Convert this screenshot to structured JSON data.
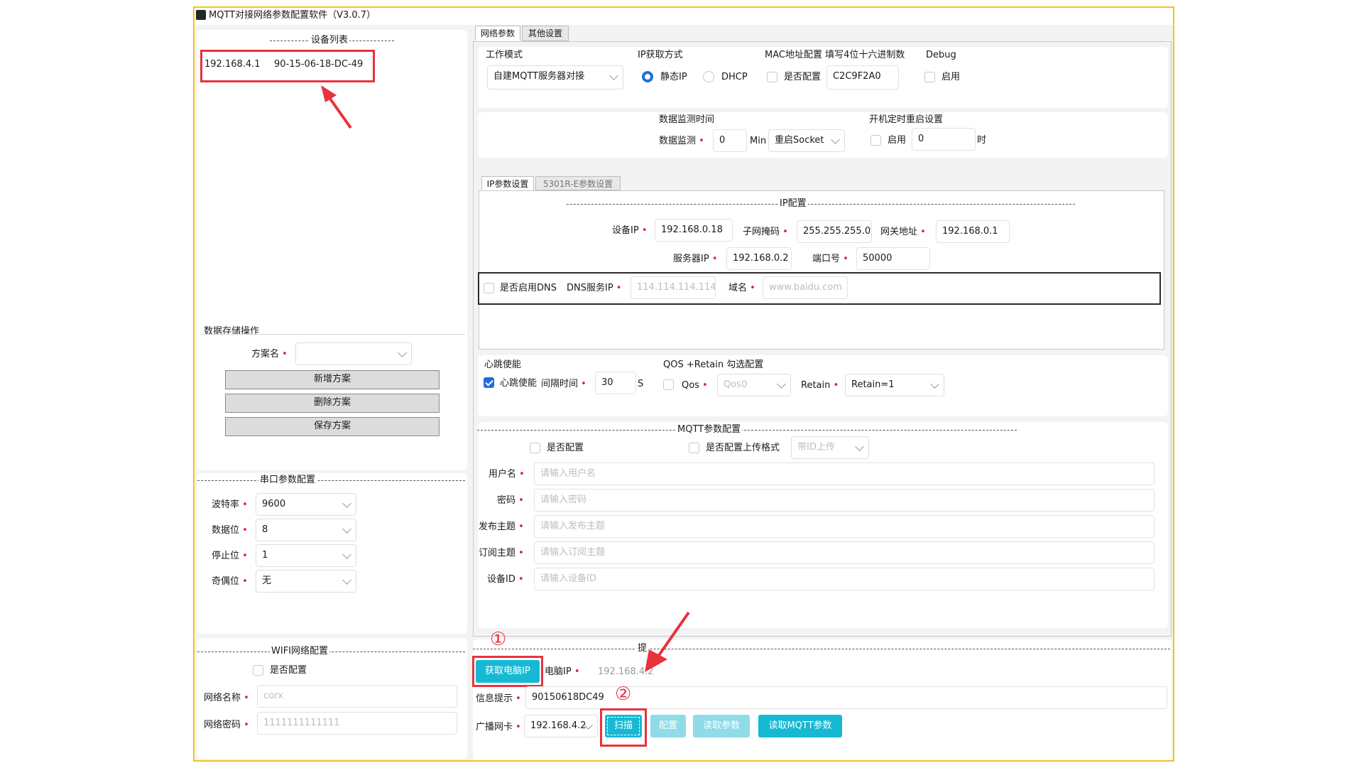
{
  "window": {
    "title": "MQTT对接网络参数配置软件（V3.0.7）"
  },
  "device_list": {
    "header": "设备列表",
    "items": [
      {
        "ip": "192.168.4.1",
        "mac": "90-15-06-18-DC-49"
      }
    ]
  },
  "data_storage": {
    "title": "数据存储操作",
    "scheme_label": "方案名",
    "scheme_value": "",
    "add_label": "新增方案",
    "delete_label": "删除方案",
    "save_label": "保存方案"
  },
  "serial": {
    "title": "串口参数配置",
    "baud_label": "波特率",
    "baud_value": "9600",
    "databits_label": "数据位",
    "databits_value": "8",
    "stopbits_label": "停止位",
    "stopbits_value": "1",
    "parity_label": "奇偶位",
    "parity_value": "无"
  },
  "wifi": {
    "title": "WIFI网络配置",
    "enable_label": "是否配置",
    "ssid_label": "网络名称",
    "ssid_placeholder": "corx",
    "password_label": "网络密码",
    "password_placeholder": "1111111111111"
  },
  "tabs": {
    "network": "网络参数",
    "other": "其他设置"
  },
  "work_mode": {
    "title": "工作模式",
    "value": "自建MQTT服务器对接"
  },
  "ip_mode": {
    "title": "IP获取方式",
    "static_label": "静态IP",
    "dhcp_label": "DHCP",
    "selected": "static"
  },
  "mac_config": {
    "title": "MAC地址配置 填写4位十六进制数",
    "enable_label": "是否配置",
    "value": "C2C9F2A0"
  },
  "debug": {
    "title": "Debug",
    "enable_label": "启用"
  },
  "monitor": {
    "title": "数据监测时间",
    "label": "数据监测",
    "value": "0",
    "unit": "Min",
    "restart_value": "重启Socket"
  },
  "timed_restart": {
    "title": "开机定时重启设置",
    "enable_label": "启用",
    "value": "0",
    "unit": "时"
  },
  "sub_tabs": {
    "ip": "IP参数设置",
    "w5301": "5301R-E参数设置"
  },
  "ip_config": {
    "title": "IP配置",
    "device_ip_label": "设备IP",
    "device_ip": "192.168.0.18",
    "subnet_label": "子网掩码",
    "subnet": "255.255.255.0",
    "gateway_label": "网关地址",
    "gateway": "192.168.0.1",
    "server_ip_label": "服务器IP",
    "server_ip": "192.168.0.2",
    "port_label": "端口号",
    "port": "50000",
    "dns_enable_label": "是否启用DNS",
    "dns_server_label": "DNS服务IP",
    "dns_server_placeholder": "114.114.114.114",
    "domain_label": "域名",
    "domain_placeholder": "www.baidu.com"
  },
  "heartbeat": {
    "title": "心跳使能",
    "enable_label": "心跳使能",
    "interval_label": "间隔时间",
    "interval_value": "30",
    "unit": "S",
    "enabled": true
  },
  "qos": {
    "title": "QOS +Retain  勾选配置",
    "qos_label": "Qos",
    "qos_value": "Qos0",
    "retain_label": "Retain",
    "retain_value": "Retain=1"
  },
  "mqtt": {
    "title": "MQTT参数配置",
    "enable_label": "是否配置",
    "upload_format_label": "是否配置上传格式",
    "upload_format_value": "带ID上传",
    "username_label": "用户名",
    "username_placeholder": "请输入用户名",
    "password_label": "密码",
    "password_placeholder": "请输入密码",
    "pub_label": "发布主题",
    "pub_placeholder": "请输入发布主题",
    "sub_label": "订阅主题",
    "sub_placeholder": "请输入订阅主题",
    "device_id_label": "设备ID",
    "device_id_placeholder": "请输入设备ID"
  },
  "bottom": {
    "section_char": "提",
    "get_pc_ip_label": "获取电脑IP",
    "pc_ip_label": "电脑IP",
    "pc_ip_value": "192.168.4.2",
    "info_label": "信息提示",
    "info_value": "90150618DC49",
    "nic_label": "广播网卡",
    "nic_value": "192.168.4.2",
    "scan_label": "扫描",
    "config_label": "配置",
    "read_params_label": "读取参数",
    "read_mqtt_label": "读取MQTT参数"
  },
  "annotations": {
    "step1": "①",
    "step2": "②"
  },
  "colors": {
    "accent": "#16b9d4",
    "highlight": "#e8323c",
    "frame": "#f5c31e",
    "check": "#1e6fdc"
  }
}
